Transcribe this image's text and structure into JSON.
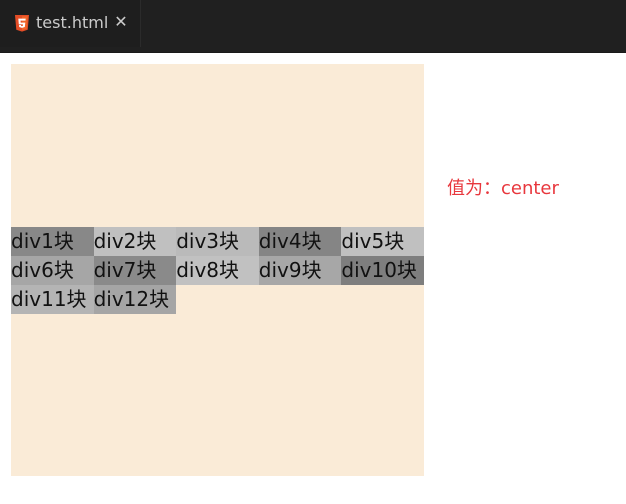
{
  "tab": {
    "title": "test.html",
    "close_glyph": "✕",
    "icon": "html5-icon",
    "icon_color": "#e44d26"
  },
  "container": {
    "background": "#faebd7",
    "items": [
      {
        "label": "div1块",
        "color": "#888888"
      },
      {
        "label": "div2块",
        "color": "#c0c0c0"
      },
      {
        "label": "div3块",
        "color": "#bababa"
      },
      {
        "label": "div4块",
        "color": "#858585"
      },
      {
        "label": "div5块",
        "color": "#c0c0c0"
      },
      {
        "label": "div6块",
        "color": "#a6a6a6"
      },
      {
        "label": "div7块",
        "color": "#8a8a8a"
      },
      {
        "label": "div8块",
        "color": "#c1c1c1"
      },
      {
        "label": "div9块",
        "color": "#a7a7a7"
      },
      {
        "label": "div10块",
        "color": "#7e7e7e"
      },
      {
        "label": "div11块",
        "color": "#b4b4b4"
      },
      {
        "label": "div12块",
        "color": "#a5a5a5"
      }
    ]
  },
  "caption": {
    "text": "值为：center",
    "color": "#e8373d"
  }
}
